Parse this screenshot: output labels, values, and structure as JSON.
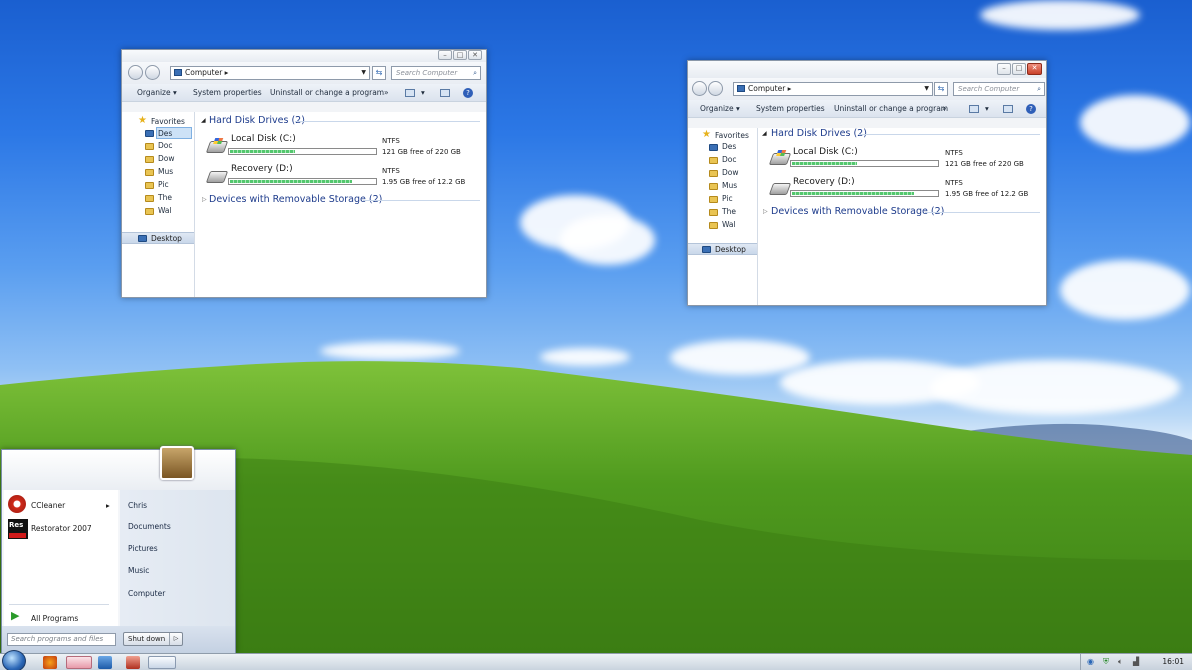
{
  "window1": {
    "address": "Computer",
    "search_placeholder": "Search Computer",
    "toolbar": {
      "organize": "Organize",
      "system_properties": "System properties",
      "uninstall": "Uninstall or change a program",
      "more": "»"
    },
    "nav": {
      "favorites": "Favorites",
      "items": [
        "Des",
        "Doc",
        "Dow",
        "Mus",
        "Pic",
        "The",
        "Wal"
      ],
      "desktop": "Desktop"
    },
    "groups": {
      "hdd": "Hard Disk Drives (2)",
      "removable": "Devices with Removable Storage (2)"
    },
    "drives": [
      {
        "name": "Local Disk (C:)",
        "fs": "NTFS",
        "free": "121 GB free of 220 GB",
        "used_fraction": 0.45
      },
      {
        "name": "Recovery (D:)",
        "fs": "NTFS",
        "free": "1.95 GB free of 12.2 GB",
        "used_fraction": 0.84
      }
    ]
  },
  "window2": {
    "address": "Computer",
    "search_placeholder": "Search Computer",
    "toolbar": {
      "organize": "Organize",
      "system_properties": "System properties",
      "uninstall": "Uninstall or change a program",
      "more": "»"
    },
    "nav": {
      "favorites": "Favorites",
      "items": [
        "Des",
        "Doc",
        "Dow",
        "Mus",
        "Pic",
        "The",
        "Wal"
      ],
      "desktop": "Desktop"
    },
    "groups": {
      "hdd": "Hard Disk Drives (2)",
      "removable": "Devices with Removable Storage (2)"
    },
    "drives": [
      {
        "name": "Local Disk (C:)",
        "fs": "NTFS",
        "free": "121 GB free of 220 GB",
        "used_fraction": 0.45
      },
      {
        "name": "Recovery (D:)",
        "fs": "NTFS",
        "free": "1.95 GB free of 12.2 GB",
        "used_fraction": 0.84
      }
    ]
  },
  "start_menu": {
    "programs": [
      {
        "label": "CCleaner",
        "arrow": "▸"
      },
      {
        "label": "Restorator 2007"
      }
    ],
    "all_programs": "All Programs",
    "right": [
      "Chris",
      "Documents",
      "Pictures",
      "Music",
      "Computer"
    ],
    "search_placeholder": "Search programs and files",
    "shutdown": "Shut down",
    "res_logo": "Res"
  },
  "taskbar": {
    "clock": "16:01"
  },
  "icons": {
    "back": "back-arrow-icon",
    "forward": "forward-arrow-icon",
    "search": "search-icon",
    "help": "help-icon"
  },
  "colors": {
    "accent": "#1e3c8c",
    "drive_fill": "#54c76e",
    "close": "#c9412a"
  }
}
